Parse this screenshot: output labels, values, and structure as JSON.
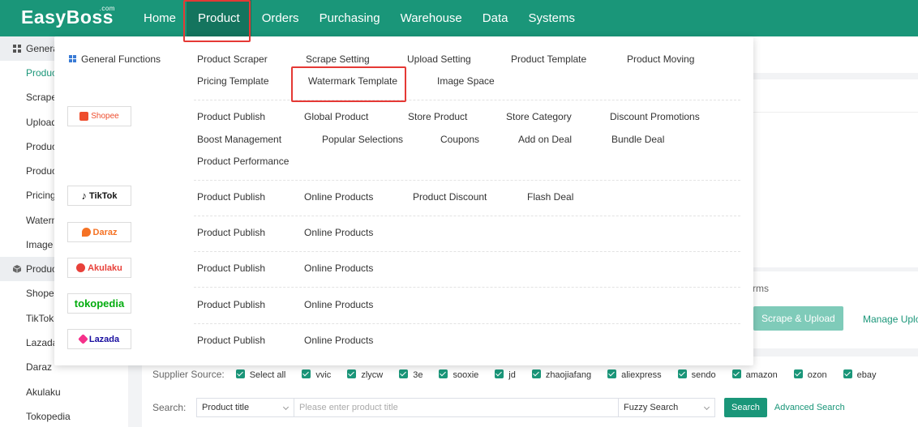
{
  "colors": {
    "brand": "#1a9679",
    "brand_dark": "#14745e",
    "highlight": "#e53935",
    "shopee": "#ee4d2d",
    "daraz": "#f57224",
    "akulaku": "#e8413a",
    "tokopedia": "#03ac0e",
    "lazada": "#1a0fa0"
  },
  "app": {
    "logo": "EasyBoss",
    "logo_sup": ".com"
  },
  "nav": {
    "home": "Home",
    "product": "Product",
    "orders": "Orders",
    "purchasing": "Purchasing",
    "warehouse": "Warehouse",
    "data": "Data",
    "systems": "Systems"
  },
  "sidebar": {
    "group1": "General Functions",
    "items1": [
      "Product Scraper",
      "Scrape Setting",
      "Upload Setting",
      "Product Template",
      "Product Moving",
      "Pricing Template",
      "Watermark Template",
      "Image Space"
    ],
    "group2": "Product Management",
    "items2": [
      "Shopee",
      "TikTok",
      "Lazada",
      "Daraz",
      "Akulaku",
      "Tokopedia"
    ]
  },
  "main": {
    "platforms_text": "rms",
    "scrape_upload": "Scrape & Upload",
    "manage_upload": "Manage Uplo",
    "supplier_label": "Supplier Source:",
    "suppliers": [
      "Select all",
      "vvic",
      "zlycw",
      "3e",
      "sooxie",
      "jd",
      "zhaojiafang",
      "aliexpress",
      "sendo",
      "amazon",
      "ozon",
      "ebay"
    ],
    "search_label": "Search:",
    "search_field": "Product title",
    "search_placeholder": "Please enter product title",
    "search_mode": "Fuzzy Search",
    "search_button": "Search",
    "advanced_search": "Advanced Search"
  },
  "menu": {
    "general_title": "General Functions",
    "general_row1": [
      "Product Scraper",
      "Scrape Setting",
      "Upload Setting",
      "Product Template",
      "Product Moving"
    ],
    "general_row2": [
      "Pricing Template",
      "Watermark Template",
      "Image Space"
    ],
    "shopee": {
      "logo": "Shopee",
      "row1": [
        "Product Publish",
        "Global Product",
        "Store Product",
        "Store Category",
        "Discount Promotions"
      ],
      "row2": [
        "Boost Management",
        "Popular Selections",
        "Coupons",
        "Add on Deal",
        "Bundle Deal"
      ],
      "row3": [
        "Product Performance"
      ]
    },
    "tiktok": {
      "logo": "TikTok",
      "items": [
        "Product Publish",
        "Online Products",
        "Product Discount",
        "Flash Deal"
      ]
    },
    "daraz": {
      "logo": "Daraz",
      "items": [
        "Product Publish",
        "Online Products"
      ]
    },
    "akulaku": {
      "logo": "Akulaku",
      "items": [
        "Product Publish",
        "Online Products"
      ]
    },
    "tokopedia": {
      "logo": "tokopedia",
      "items": [
        "Product Publish",
        "Online Products"
      ]
    },
    "lazada": {
      "logo": "Lazada",
      "items": [
        "Product Publish",
        "Online Products"
      ]
    }
  }
}
